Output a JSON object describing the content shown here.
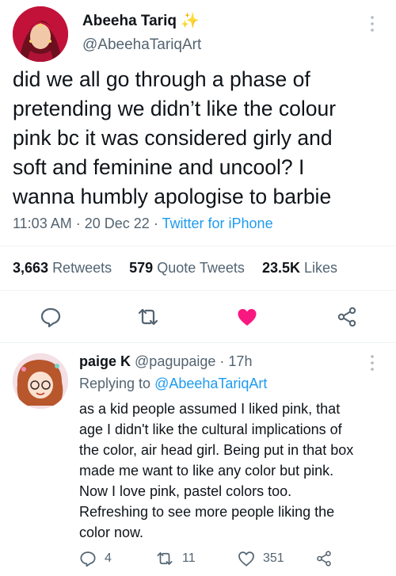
{
  "main_tweet": {
    "author_name": "Abeeha Tariq",
    "author_badge": "✨",
    "author_handle": "@AbeehaTariqArt",
    "text_lines": [
      "did we all go through a phase of",
      "pretending we didn’t like the colour",
      "pink bc it was considered girly and",
      "soft and feminine and uncool? I",
      "wanna humbly apologise to barbie"
    ],
    "time": "11:03 AM",
    "date": "20 Dec 22",
    "separator": "·",
    "source": "Twitter for iPhone",
    "stats": {
      "retweets_count": "3,663",
      "retweets_label": "Retweets",
      "quotes_count": "579",
      "quotes_label": "Quote Tweets",
      "likes_count": "23.5K",
      "likes_label": "Likes"
    },
    "icons": [
      "reply-icon",
      "retweet-icon",
      "like-icon-filled",
      "share-icon"
    ],
    "like_color": "#f91880"
  },
  "reply": {
    "author_name": "paige K",
    "author_handle": "@pagupaige",
    "time_ago": "17h",
    "replying_label": "Replying to",
    "replying_handle": "@AbeehaTariqArt",
    "text_lines": [
      "as a kid people assumed I liked pink, that",
      "age I didn't like the cultural implications of",
      "the color, air head girl. Being put in that box",
      "made me want to like any color but pink.",
      "Now I love pink, pastel colors too.",
      "Refreshing to see more people liking the",
      "color now."
    ],
    "actions": {
      "replies": "4",
      "retweets": "11",
      "likes": "351"
    }
  },
  "colors": {
    "accent": "#1d9bf0",
    "text": "#0f1419",
    "muted": "#536471",
    "divider": "#eff3f4"
  }
}
